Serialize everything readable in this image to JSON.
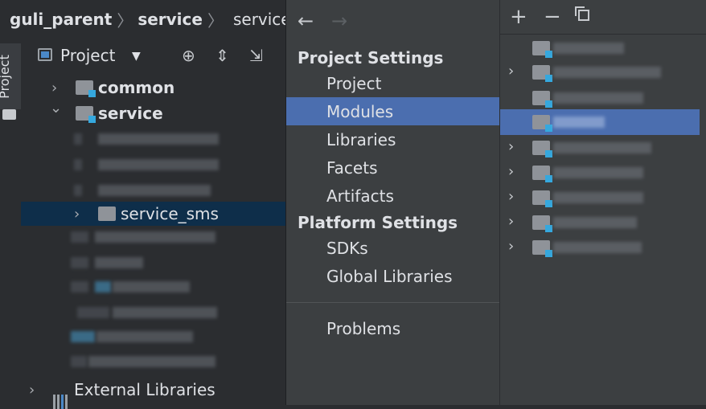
{
  "breadcrumb": {
    "root": "guli_parent",
    "second": "service",
    "third": "service_s",
    "separator": "〉"
  },
  "toolstrip": {
    "tab_label": "Project"
  },
  "project_panel": {
    "view_label": "Project",
    "caret": "▼",
    "icons": {
      "locate": "⊕",
      "expand_all": "⇕",
      "collapse_all": "⇲"
    },
    "tree": {
      "common": "common",
      "service": "service",
      "service_sms": "service_sms",
      "external_libraries": "External Libraries"
    },
    "arrow_collapsed": "›",
    "arrow_expanded": "⌄"
  },
  "settings": {
    "back": "←",
    "forward": "→",
    "project_settings": "Project Settings",
    "project_items": [
      "Project",
      "Modules",
      "Libraries",
      "Facets",
      "Artifacts"
    ],
    "platform_settings": "Platform Settings",
    "platform_items": [
      "SDKs",
      "Global Libraries"
    ],
    "problems": "Problems",
    "active_item": "Modules"
  },
  "modules": {
    "toolbar": {
      "add": "+",
      "remove": "−"
    }
  },
  "colors": {
    "selection": "#4b6eaf",
    "tree_selection": "#0e2e4a",
    "module_marker": "#35a8de",
    "dialog_bg": "#3c3f41",
    "panel_bg": "#2b2d30"
  }
}
